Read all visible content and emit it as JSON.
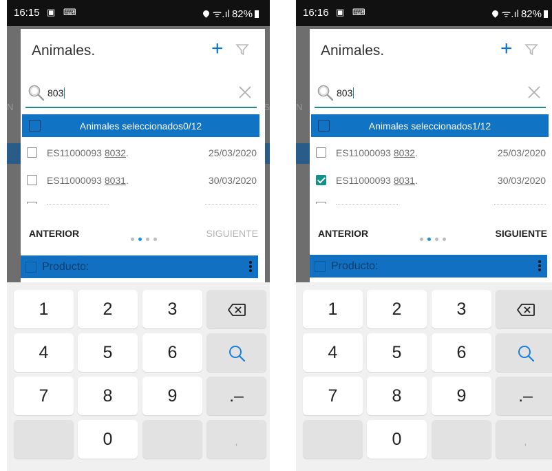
{
  "screens": [
    {
      "status": {
        "time": "16:15",
        "icons": "▣ ⌨",
        "signal": "ᯤ.ıl",
        "battery": "82%"
      },
      "bg": {
        "left_cut": "N",
        "right_cut": "S"
      },
      "dialog": {
        "title": "Animales.",
        "search_value": "803",
        "selection_text": "Animales seleccionados0/12",
        "rows": [
          {
            "prefix": "ES11000093 ",
            "code": "8032",
            "suffix": ".",
            "date": "25/03/2020",
            "checked": false
          },
          {
            "prefix": "ES11000093 ",
            "code": "8031",
            "suffix": ".",
            "date": "30/03/2020",
            "checked": false
          }
        ],
        "prev_label": "ANTERIOR",
        "next_label": "SIGUIENTE",
        "next_enabled": false,
        "pagination_active_index": 1,
        "product_label": "Producto:"
      }
    },
    {
      "status": {
        "time": "16:16",
        "icons": "▣ ⌨",
        "signal": "ᯤ.ıl",
        "battery": "82%"
      },
      "bg": {
        "left_cut": "N",
        "right_cut": ""
      },
      "dialog": {
        "title": "Animales.",
        "search_value": "803",
        "selection_text": "Animales seleccionados1/12",
        "rows": [
          {
            "prefix": "ES11000093 ",
            "code": "8032",
            "suffix": ".",
            "date": "25/03/2020",
            "checked": false
          },
          {
            "prefix": "ES11000093 ",
            "code": "8031",
            "suffix": ".",
            "date": "30/03/2020",
            "checked": true
          }
        ],
        "prev_label": "ANTERIOR",
        "next_label": "SIGUIENTE",
        "next_enabled": true,
        "pagination_active_index": 1,
        "product_label": "Producto:"
      }
    }
  ],
  "keyboard": {
    "rows": [
      [
        "1",
        "2",
        "3",
        "backspace"
      ],
      [
        "4",
        "5",
        "6",
        "search"
      ],
      [
        "7",
        "8",
        "9",
        ".–"
      ],
      [
        "",
        "0",
        "",
        ","
      ]
    ]
  },
  "colors": {
    "accent_blue": "#1073c3",
    "teal": "#1f8a86",
    "search_blue": "#1a7fdc"
  }
}
